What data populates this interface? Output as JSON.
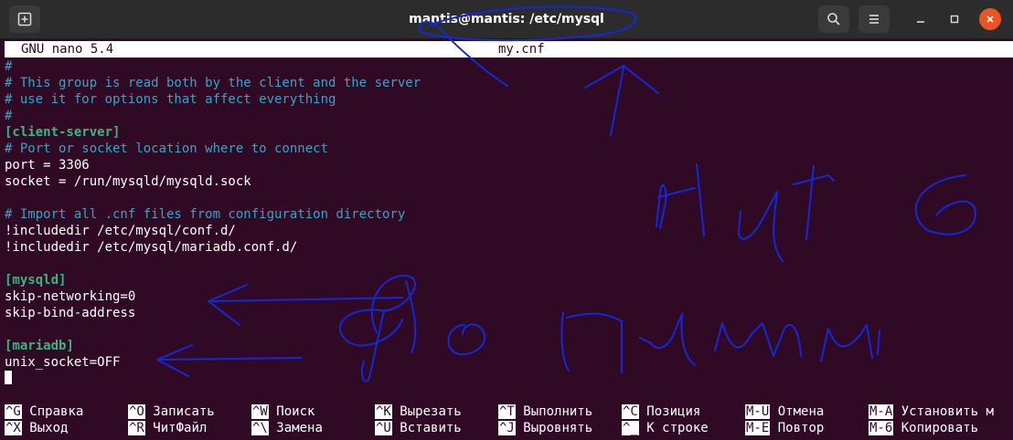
{
  "window": {
    "title": "mantis@mantis: /etc/mysql",
    "background": "#300a24"
  },
  "nano": {
    "version": "GNU nano 5.4",
    "filename": "my.cnf"
  },
  "lines": [
    {
      "text": "#",
      "kind": "comment"
    },
    {
      "text": "# This group is read both by the client and the server",
      "kind": "comment"
    },
    {
      "text": "# use it for options that affect everything",
      "kind": "comment"
    },
    {
      "text": "#",
      "kind": "comment"
    },
    {
      "text": "[client-server]",
      "kind": "section"
    },
    {
      "text": "# Port or socket location where to connect",
      "kind": "comment"
    },
    {
      "text": "port = 3306",
      "kind": "plain"
    },
    {
      "text": "socket = /run/mysqld/mysqld.sock",
      "kind": "plain"
    },
    {
      "text": "",
      "kind": "plain"
    },
    {
      "text": "# Import all .cnf files from configuration directory",
      "kind": "comment"
    },
    {
      "text": "!includedir /etc/mysql/conf.d/",
      "kind": "plain"
    },
    {
      "text": "!includedir /etc/mysql/mariadb.conf.d/",
      "kind": "plain"
    },
    {
      "text": "",
      "kind": "plain"
    },
    {
      "text": "[mysqld]",
      "kind": "section"
    },
    {
      "text": "skip-networking=0",
      "kind": "plain"
    },
    {
      "text": "skip-bind-address",
      "kind": "plain"
    },
    {
      "text": "",
      "kind": "plain"
    },
    {
      "text": "[mariadb]",
      "kind": "section"
    },
    {
      "text": "unix_socket=OFF",
      "kind": "plain"
    }
  ],
  "shortcuts": {
    "row1": [
      {
        "key": "^G",
        "label": "Справка"
      },
      {
        "key": "^O",
        "label": "Записать"
      },
      {
        "key": "^W",
        "label": "Поиск"
      },
      {
        "key": "^K",
        "label": "Вырезать"
      },
      {
        "key": "^T",
        "label": "Выполнить"
      },
      {
        "key": "^C",
        "label": "Позиция"
      },
      {
        "key": "M-U",
        "label": "Отмена"
      },
      {
        "key": "M-A",
        "label": "Установить м"
      }
    ],
    "row2": [
      {
        "key": "^X",
        "label": "Выход"
      },
      {
        "key": "^R",
        "label": "ЧитФайл"
      },
      {
        "key": "^\\",
        "label": "Замена"
      },
      {
        "key": "^U",
        "label": "Вставить"
      },
      {
        "key": "^J",
        "label": "Выровнять"
      },
      {
        "key": "^_",
        "label": "К строке"
      },
      {
        "key": "M-E",
        "label": "Повтор"
      },
      {
        "key": "M-6",
        "label": "Копировать"
      }
    ]
  },
  "icons": {
    "new_tab": "new-tab-icon",
    "search": "search-icon",
    "menu": "hamburger-menu-icon",
    "minimize": "minimize-icon",
    "maximize": "maximize-icon",
    "close": "close-icon"
  },
  "colors": {
    "comment": "#38a3c7",
    "section": "#3fb37f",
    "close_button": "#e95420",
    "annotation_ink": "#1428d8"
  }
}
